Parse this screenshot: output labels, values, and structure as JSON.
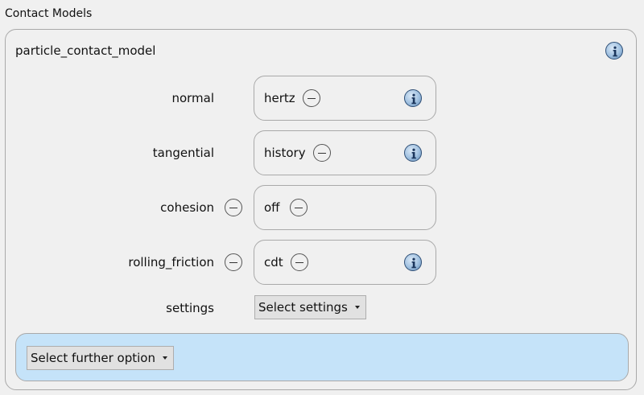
{
  "section": {
    "title": "Contact Models"
  },
  "model": {
    "name": "particle_contact_model",
    "rows": [
      {
        "label": "normal",
        "value": "hertz"
      },
      {
        "label": "tangential",
        "value": "history"
      },
      {
        "label": "cohesion",
        "value": "off"
      },
      {
        "label": "rolling_friction",
        "value": "cdt"
      }
    ],
    "settings": {
      "label": "settings",
      "dropdown": "Select settings"
    },
    "further": {
      "dropdown": "Select further option"
    }
  },
  "colors": {
    "background": "#f0f0f0",
    "border": "#a9a9a9",
    "further_option_bg": "#c5e3f9",
    "dropdown_bg": "#e1e1e1",
    "info_icon_blue": "#5d86b3"
  },
  "icons": {
    "info": "info-icon",
    "remove": "minus-circle-icon",
    "dropdown": "caret-down-icon"
  }
}
